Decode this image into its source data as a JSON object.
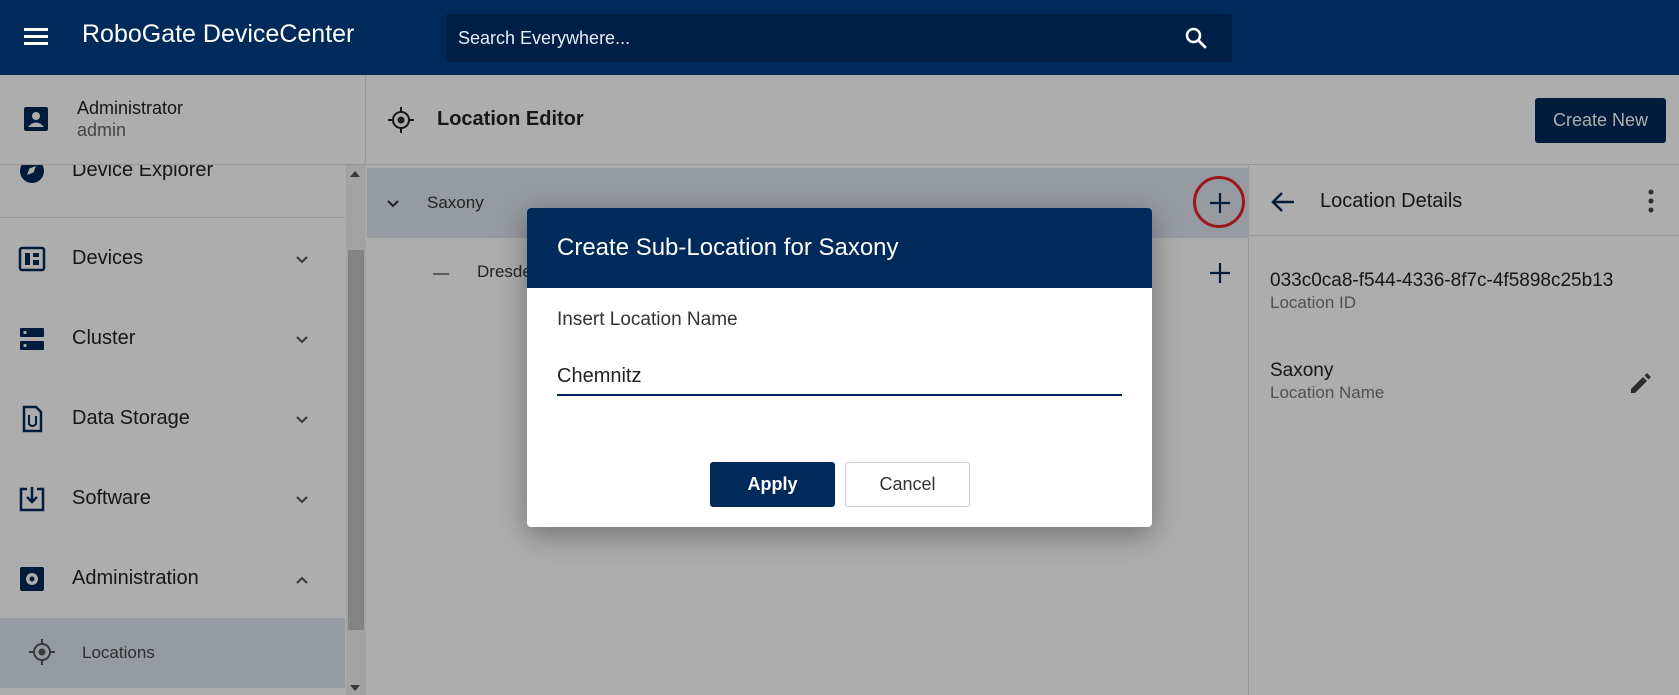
{
  "header": {
    "app_title": "RoboGate DeviceCenter",
    "search_placeholder": "Search Everywhere..."
  },
  "user": {
    "name": "Administrator",
    "login": "admin"
  },
  "sidebar": {
    "items": [
      {
        "label": "Device Explorer",
        "icon": "compass-icon"
      },
      {
        "label": "Devices",
        "icon": "devices-icon"
      },
      {
        "label": "Cluster",
        "icon": "cluster-icon"
      },
      {
        "label": "Data Storage",
        "icon": "data-storage-icon"
      },
      {
        "label": "Software",
        "icon": "software-download-icon"
      },
      {
        "label": "Administration",
        "icon": "admin-gear-icon"
      }
    ],
    "sub_item": {
      "label": "Locations",
      "icon": "location-target-icon"
    }
  },
  "main": {
    "title": "Location Editor",
    "create_button": "Create New"
  },
  "tree": {
    "rows": [
      {
        "label": "Saxony"
      },
      {
        "label": "Dresden"
      }
    ]
  },
  "details": {
    "title": "Location Details",
    "location_id": "033c0ca8-f544-4336-8f7c-4f5898c25b13",
    "location_id_label": "Location ID",
    "location_name": "Saxony",
    "location_name_label": "Location Name"
  },
  "dialog": {
    "title": "Create Sub-Location for Saxony",
    "field_label": "Insert Location Name",
    "field_value": "Chemnitz",
    "apply": "Apply",
    "cancel": "Cancel"
  },
  "colors": {
    "brand": "#002a5a",
    "highlight": "#e8242c",
    "selected_row": "#dde3ee"
  }
}
